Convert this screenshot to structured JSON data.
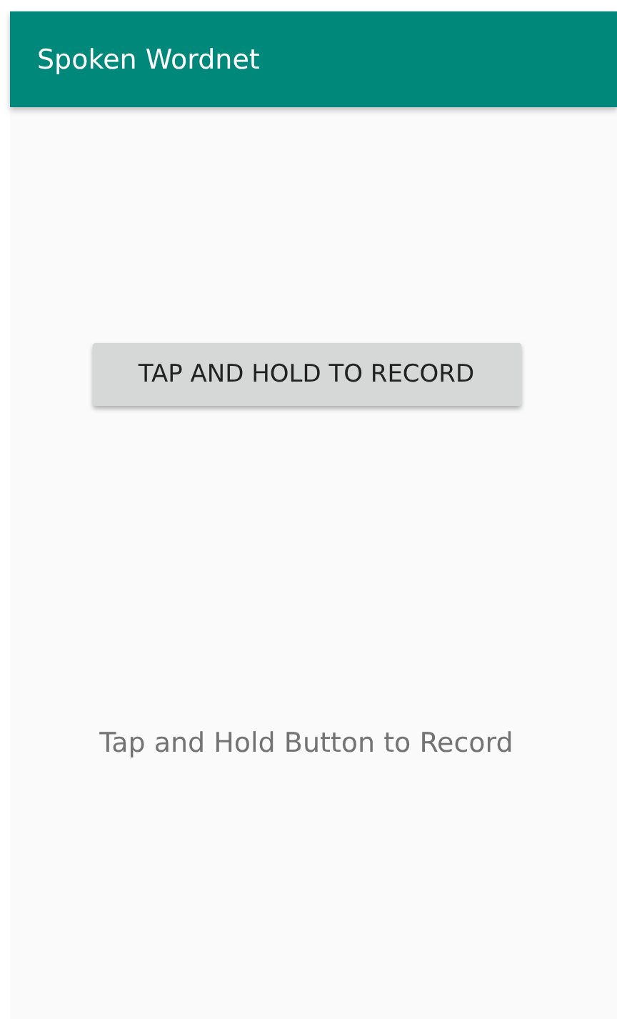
{
  "app_bar": {
    "title": "Spoken Wordnet"
  },
  "record_button": {
    "label": "TAP AND HOLD TO RECORD"
  },
  "hint": "Tap and Hold Button to Record"
}
